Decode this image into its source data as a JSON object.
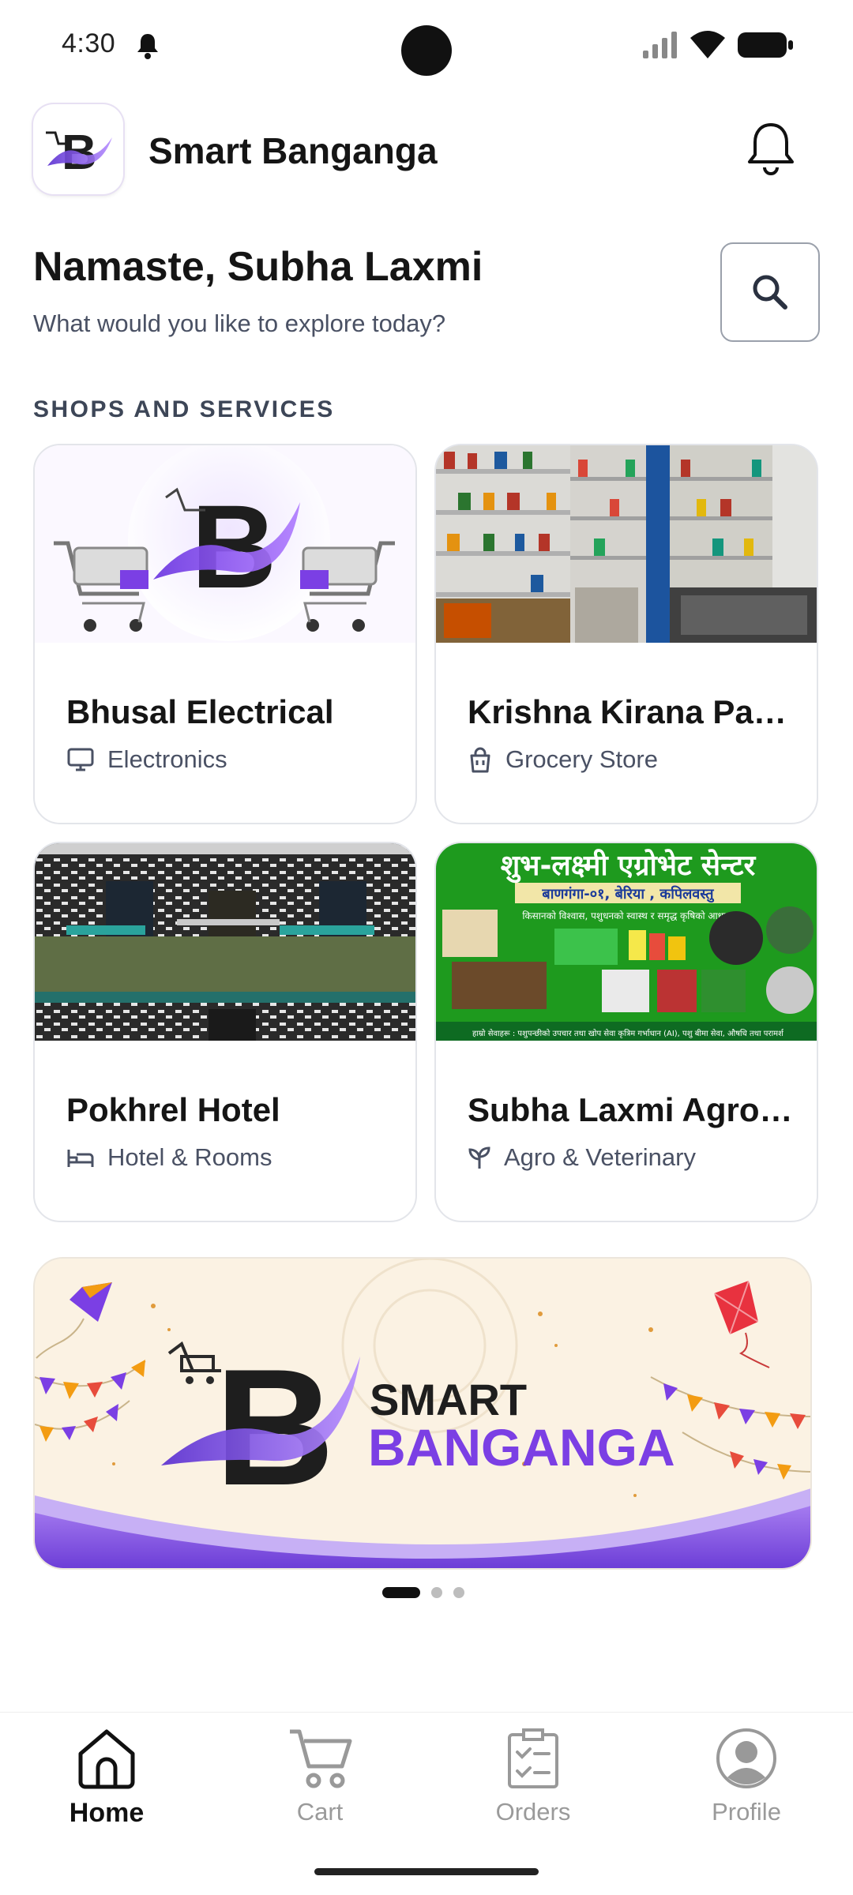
{
  "status_bar": {
    "time": "4:30"
  },
  "header": {
    "app_title": "Smart Banganga"
  },
  "greeting": {
    "title": "Namaste, Subha Laxmi",
    "subtitle": "What would you like to explore today?"
  },
  "section": {
    "title": "SHOPS AND SERVICES"
  },
  "shops": [
    {
      "name": "Bhusal Electrical",
      "category": "Electronics",
      "icon": "monitor-icon"
    },
    {
      "name": "Krishna Kirana Pasal",
      "category": "Grocery Store",
      "icon": "shopping-bag-icon"
    },
    {
      "name": "Pokhrel Hotel",
      "category": "Hotel & Rooms",
      "icon": "bed-icon"
    },
    {
      "name": "Subha Laxmi Agrovet Center",
      "category": "Agro & Veterinary",
      "icon": "sprout-icon"
    }
  ],
  "sign_text": {
    "title": "शुभ-लक्ष्मी एग्रोभेट सेन्टर",
    "address": "बाणगंगा-०१, बेरिया , कपिलवस्तु",
    "tagline": "किसानको विश्वास, पशुधनको स्वास्थ र समृद्ध कृषिको आधार।",
    "footer": "हाम्रो सेवाहरू : पशुपन्छीको उपचार तथा खोप सेवा कृत्रिम गर्भाधान (AI), पशु बीमा सेवा, औषधि तथा परामर्श"
  },
  "banner": {
    "line1": "SMART",
    "line2": "BANGANGA",
    "slide_count": 3,
    "active_slide": 1
  },
  "bottom_nav": [
    {
      "label": "Home",
      "icon": "home-icon",
      "active": true
    },
    {
      "label": "Cart",
      "icon": "cart-icon",
      "active": false
    },
    {
      "label": "Orders",
      "icon": "clipboard-check-icon",
      "active": false
    },
    {
      "label": "Profile",
      "icon": "user-icon",
      "active": false
    }
  ],
  "colors": {
    "brand_purple": "#7B3FE4",
    "brand_dark": "#1E1E1E",
    "text_muted": "#4A5164",
    "card_border": "#E3E5EA",
    "sign_green": "#1E9A1E",
    "banner_bg": "#FBF2E3"
  }
}
